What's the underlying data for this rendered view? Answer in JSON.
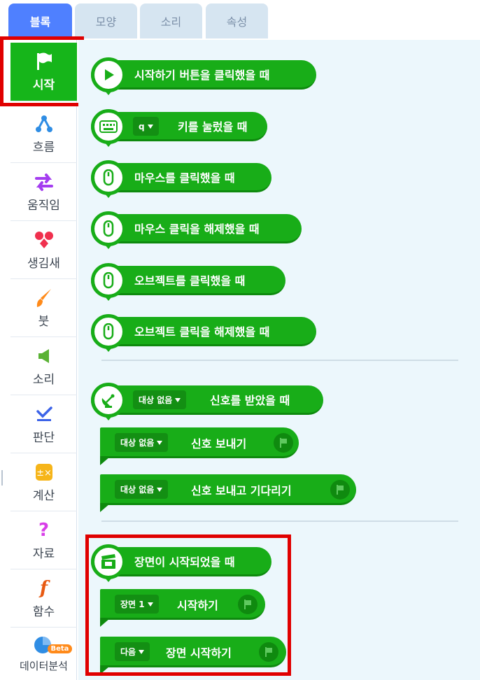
{
  "tabs": [
    {
      "label": "블록",
      "active": true
    },
    {
      "label": "모양",
      "active": false
    },
    {
      "label": "소리",
      "active": false
    },
    {
      "label": "속성",
      "active": false
    }
  ],
  "sidebar": {
    "items": [
      {
        "label": "시작",
        "icon": "flag-icon",
        "active": true
      },
      {
        "label": "흐름",
        "icon": "flow-icon"
      },
      {
        "label": "움직임",
        "icon": "move-arrows-icon"
      },
      {
        "label": "생김새",
        "icon": "shapes-icon"
      },
      {
        "label": "붓",
        "icon": "brush-icon"
      },
      {
        "label": "소리",
        "icon": "speaker-icon"
      },
      {
        "label": "판단",
        "icon": "check-icon"
      },
      {
        "label": "계산",
        "icon": "calculator-icon"
      },
      {
        "label": "자료",
        "icon": "question-icon"
      },
      {
        "label": "함수",
        "icon": "function-icon"
      },
      {
        "label": "데이터분석",
        "icon": "pie-chart-icon",
        "badge": "Beta"
      }
    ]
  },
  "blocks": {
    "start_button": "시작하기 버튼을 클릭했을 때",
    "key_dropdown": "q",
    "key_pressed": "키를 눌렀을 때",
    "mouse_click": "마우스를 클릭했을 때",
    "mouse_release": "마우스 클릭을 해제했을 때",
    "object_click": "오브젝트를 클릭했을 때",
    "object_release": "오브젝트 클릭을 해제했을 때",
    "signal_dropdown": "대상 없음",
    "signal_received": "신호를 받았을 때",
    "signal_send": "신호 보내기",
    "signal_send_wait": "신호 보내고 기다리기",
    "scene_started": "장면이 시작되었을 때",
    "scene_dropdown": "장면 1",
    "start_scene": "시작하기",
    "next_dropdown": "다음",
    "next_scene": "장면 시작하기"
  },
  "colors": {
    "block_green": "#18ad18",
    "highlight_red": "#e00000",
    "tab_active": "#4f80ff"
  }
}
